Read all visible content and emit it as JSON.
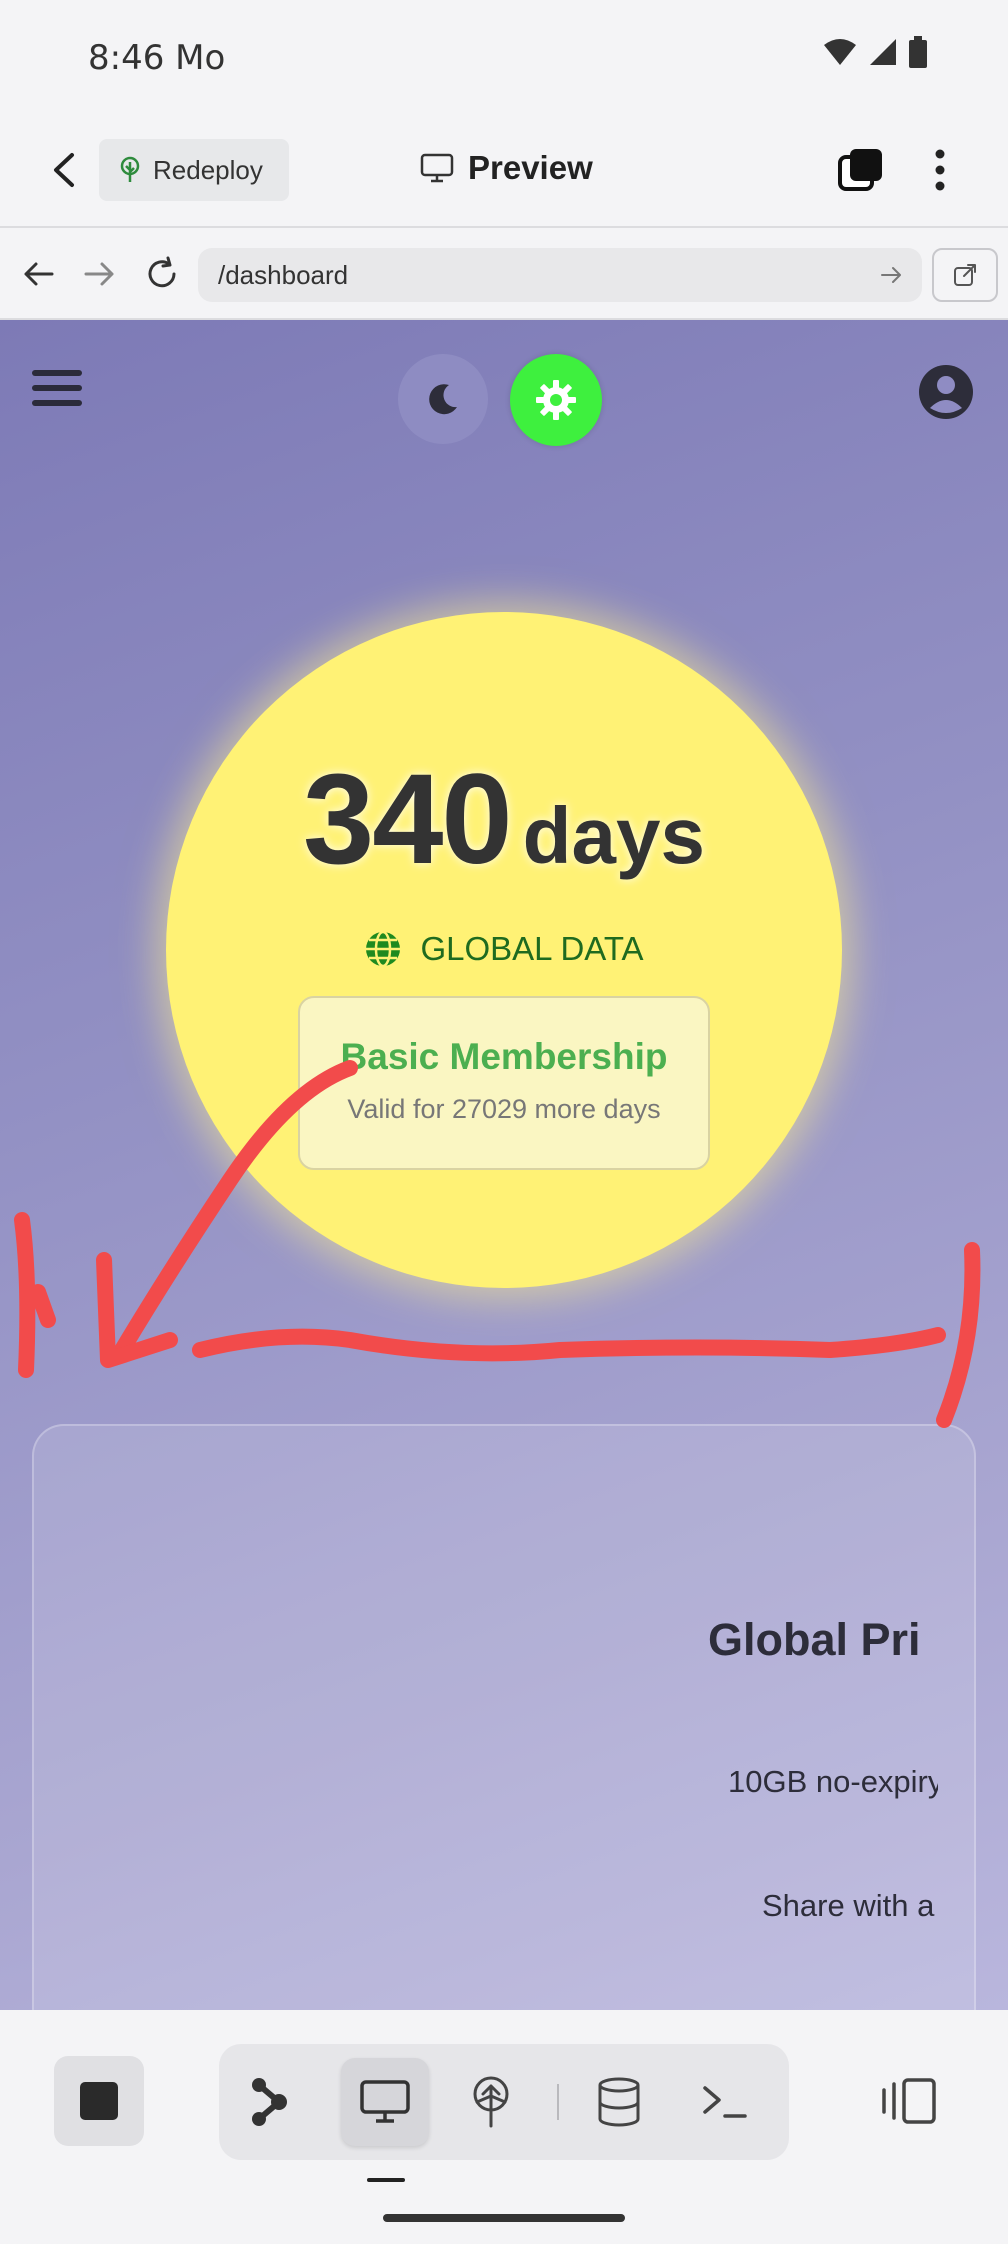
{
  "status_bar": {
    "time": "8:46 Mo"
  },
  "app_header": {
    "redeploy_label": "Redeploy",
    "preview_label": "Preview"
  },
  "browser": {
    "url": "/dashboard"
  },
  "dashboard": {
    "days_value": "340",
    "days_unit": "days",
    "data_type_label": "GLOBAL DATA",
    "membership_title": "Basic Membership",
    "membership_validity": "Valid for 27029 more days",
    "plan_title": "Global Pri",
    "plan_feature_1": "10GB no-expiry",
    "plan_feature_2": "Share with a"
  },
  "colors": {
    "sun_yellow": "#fff275",
    "theme_toggle_active": "#3ef03e",
    "membership_green": "#4caf50",
    "global_data_green": "#1f6b1f",
    "annotation_red": "#f24b4b"
  },
  "icons": {
    "status": [
      "wifi-icon",
      "signal-icon",
      "battery-icon"
    ],
    "header": [
      "back-arrow-icon",
      "tree-icon",
      "monitor-icon",
      "tabs-icon",
      "more-vert-icon"
    ],
    "browser": [
      "back-icon",
      "forward-icon",
      "reload-icon",
      "go-icon",
      "open-external-icon"
    ],
    "dashboard": [
      "hamburger-icon",
      "moon-icon",
      "gear-icon",
      "user-account-icon",
      "globe-icon"
    ],
    "bottom": [
      "stop-icon",
      "graph-nodes-icon",
      "monitor-icon",
      "deploy-icon",
      "database-icon",
      "terminal-icon",
      "split-view-icon"
    ]
  }
}
